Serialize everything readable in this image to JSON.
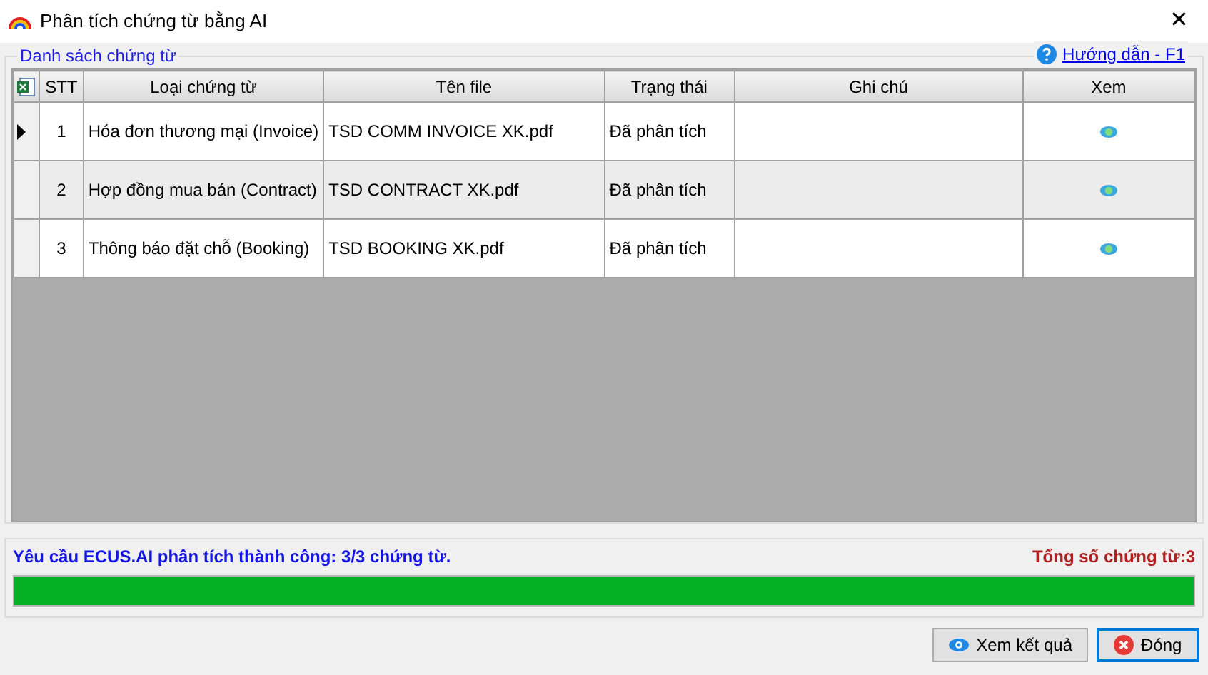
{
  "window": {
    "title": "Phân tích chứng từ bằng AI",
    "close": "✕"
  },
  "group": {
    "title": "Danh sách chứng từ",
    "help_link": "Hướng dẫn - F1"
  },
  "table": {
    "columns": [
      "STT",
      "Loại chứng từ",
      "Tên file",
      "Trạng thái",
      "Ghi chú",
      "Xem"
    ],
    "rows": [
      {
        "stt": "1",
        "type": "Hóa đơn thương mại (Invoice)",
        "file": "TSD COMM INVOICE XK.pdf",
        "status": "Đã phân tích",
        "current": true
      },
      {
        "stt": "2",
        "type": "Hợp đồng mua bán (Contract)",
        "file": "TSD CONTRACT XK.pdf",
        "status": "Đã phân tích",
        "current": false
      },
      {
        "stt": "3",
        "type": "Thông báo đặt chỗ (Booking)",
        "file": "TSD BOOKING XK.pdf",
        "status": "Đã phân tích",
        "current": false
      }
    ]
  },
  "progress": {
    "message": "Yêu cầu ECUS.AI phân tích thành công: 3/3 chứng từ.",
    "total": "Tổng số chứng từ:3",
    "level": 1
  },
  "buttons": [
    {
      "label": "Xem kết quả",
      "kind": "view",
      "default": false
    },
    {
      "label": "Đóng",
      "kind": "close",
      "default": true
    }
  ]
}
